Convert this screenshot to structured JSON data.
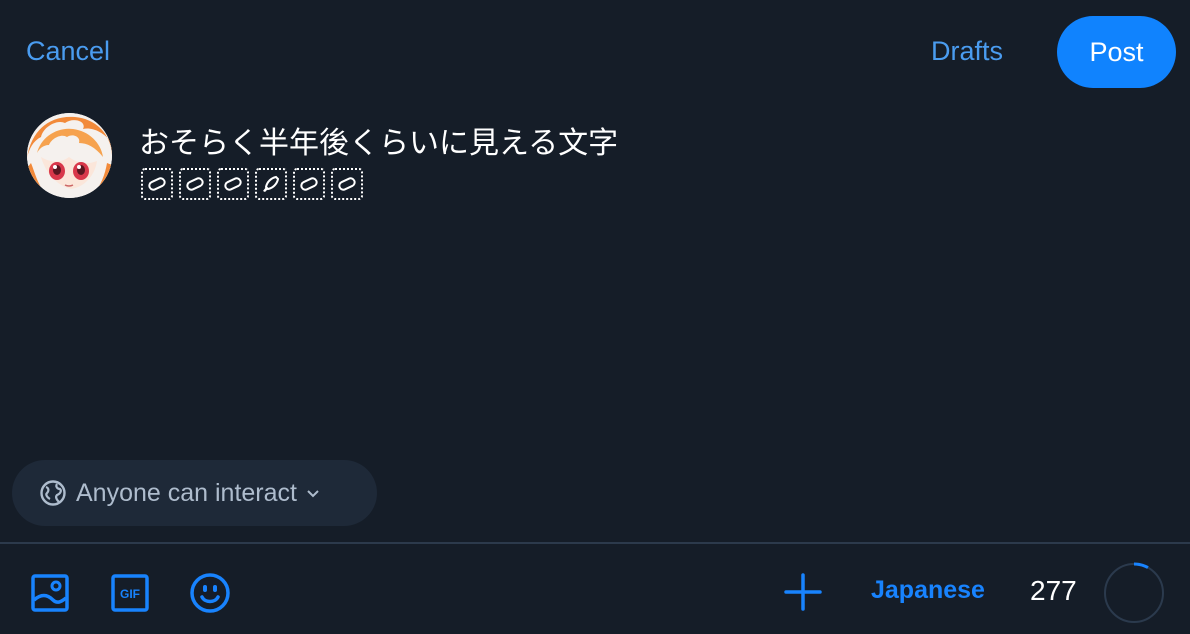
{
  "header": {
    "cancel_label": "Cancel",
    "drafts_label": "Drafts",
    "post_label": "Post"
  },
  "composer": {
    "text": "おそらく半年後くらいに見える文字",
    "stickers": [
      "plaster",
      "plaster",
      "plaster",
      "rocket",
      "plaster",
      "plaster"
    ]
  },
  "interaction": {
    "label": "Anyone can interact",
    "icon": "globe-icon"
  },
  "toolbar": {
    "icons": [
      "image-icon",
      "gif-icon",
      "emoji-icon",
      "plus-icon"
    ],
    "language": "Japanese",
    "char_count": "277",
    "progress_fraction": 0.08
  },
  "colors": {
    "background": "#151d28",
    "accent": "#1083fe",
    "link": "#4a9cf0",
    "pill": "#1e2938"
  }
}
